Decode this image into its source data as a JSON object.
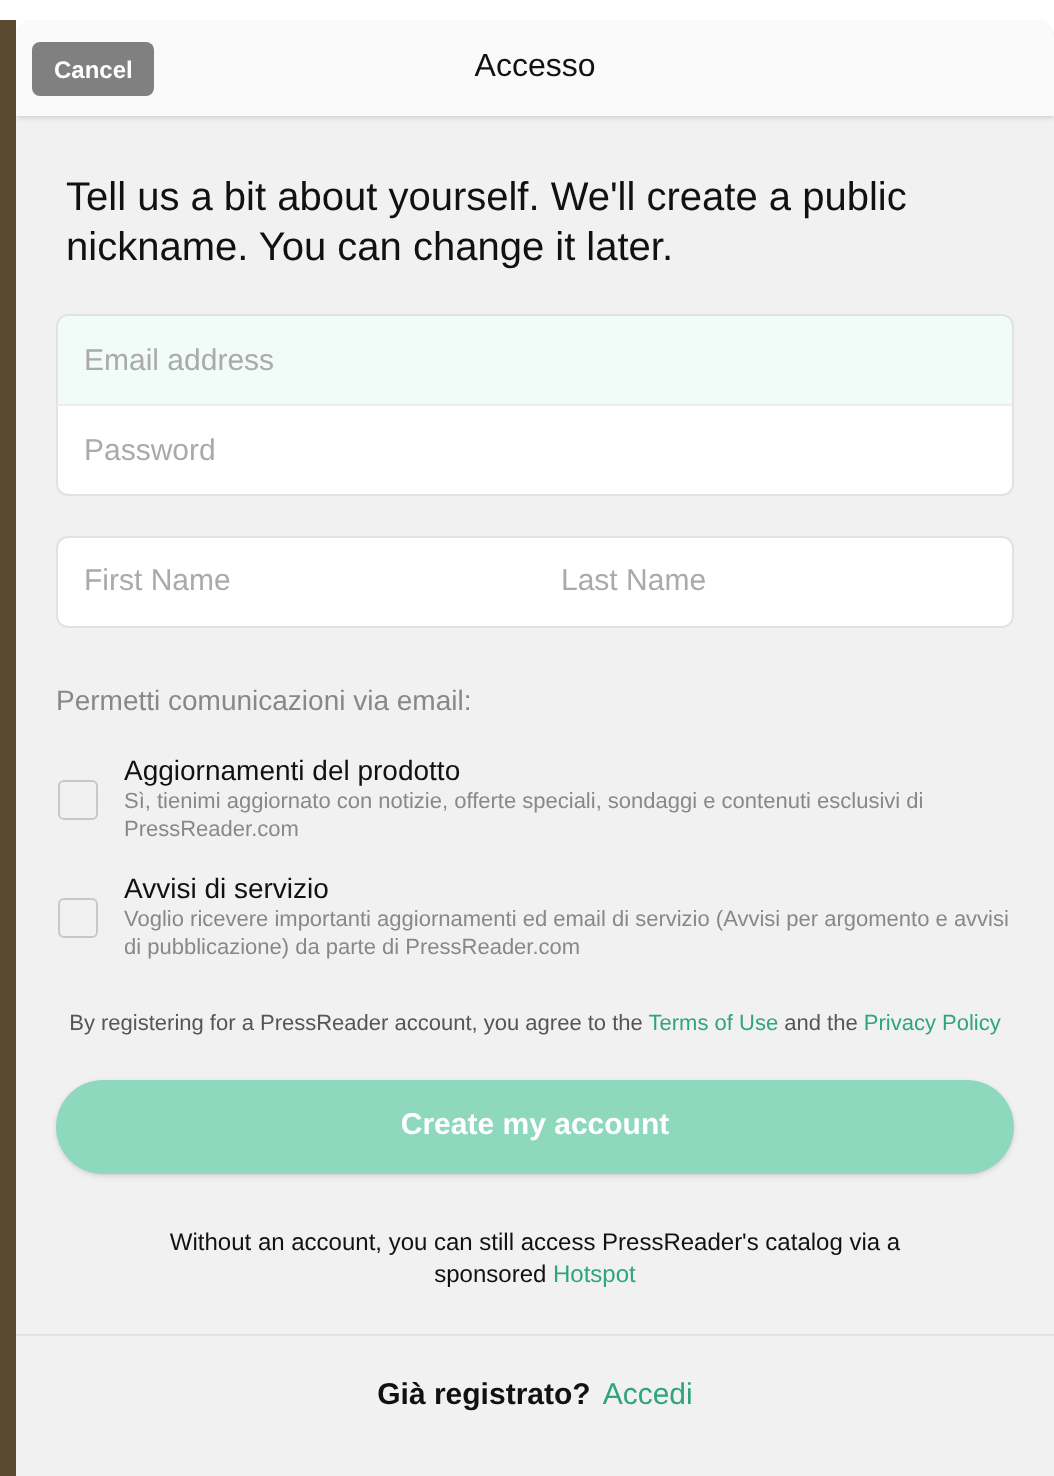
{
  "header": {
    "cancel": "Cancel",
    "title": "Accesso"
  },
  "intro": "Tell us a bit about yourself. We'll create a public nickname. You can change it later.",
  "credentials": [
    {
      "placeholder": "Email address",
      "focused": true
    },
    {
      "placeholder": "Password",
      "focused": false
    }
  ],
  "name_fields": [
    {
      "placeholder": "First Name"
    },
    {
      "placeholder": "Last Name"
    }
  ],
  "email_prefs": {
    "label": "Permetti comunicazioni via email:",
    "options": [
      {
        "title": "Aggiornamenti del prodotto",
        "description": "Sì, tienimi aggiornato con notizie, offerte speciali, sondaggi e contenuti esclusivi di PressReader.com",
        "checked": false
      },
      {
        "title": "Avvisi di servizio",
        "description": "Voglio ricevere importanti aggiornamenti ed email di servizio (Avvisi per argomento e avvisi di pubblicazione) da parte di PressReader.com",
        "checked": false
      }
    ]
  },
  "legal": {
    "before": "By registering for a PressReader account, you agree to the ",
    "terms_link": "Terms of Use",
    "middle": " and the ",
    "privacy_link": "Privacy Policy"
  },
  "create_button": {
    "label": "Create my account",
    "disabled": true
  },
  "hotspot": {
    "text": "Without an account, you can still access PressReader's catalog via a sponsored ",
    "link": "Hotspot"
  },
  "footer": {
    "question": "Già registrato?",
    "link": "Accedi"
  }
}
